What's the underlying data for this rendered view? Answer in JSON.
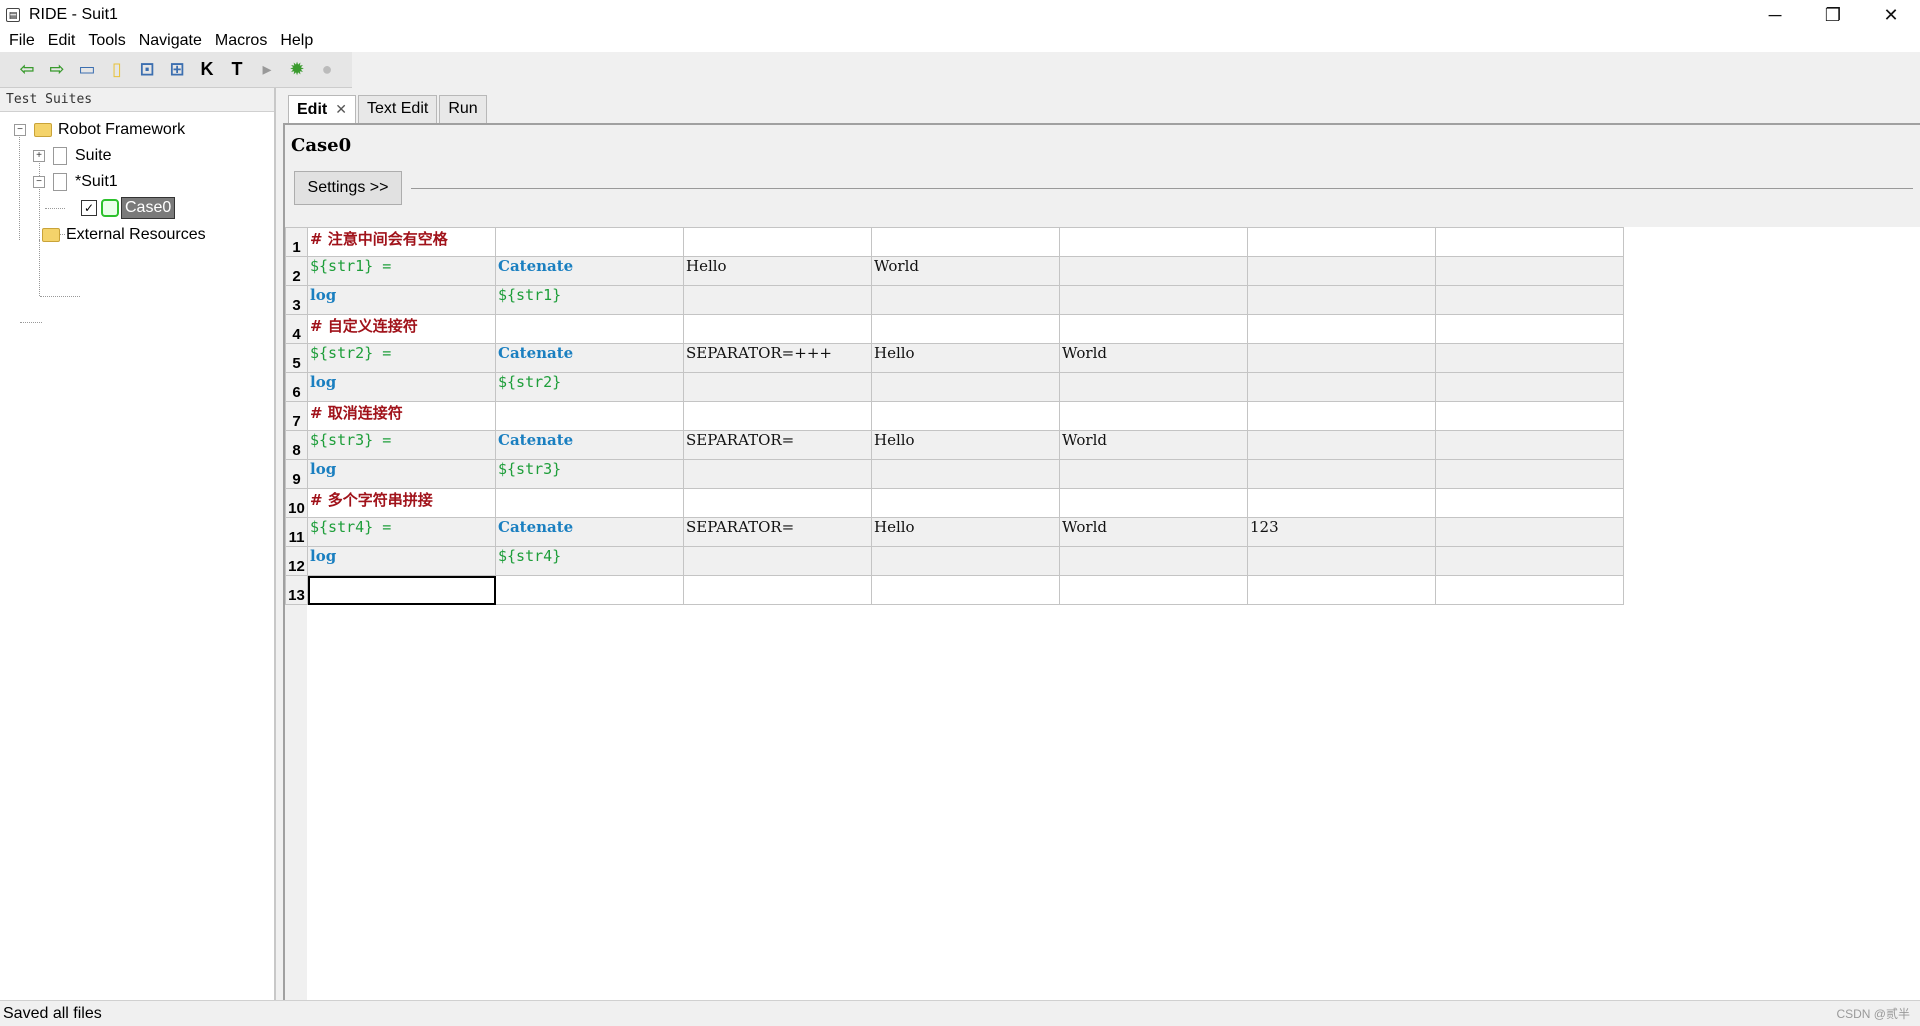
{
  "window": {
    "title": "RIDE - Suit1",
    "controls": {
      "minimize": "─",
      "restore": "❐",
      "close": "✕"
    }
  },
  "menu": [
    "File",
    "Edit",
    "Tools",
    "Navigate",
    "Macros",
    "Help"
  ],
  "toolbar": {
    "icons": [
      "back-icon",
      "forward-icon",
      "open-folder-icon",
      "new-file-icon",
      "save-icon",
      "save-all-icon",
      "keyword-search-icon",
      "test-search-icon",
      "run-icon",
      "debug-icon",
      "stop-icon"
    ],
    "glyphs": [
      "⇦",
      "⇨",
      "▭",
      "▯",
      "⊡",
      "⊞",
      "K",
      "T",
      "▸",
      "✹",
      "●"
    ]
  },
  "left_pane": {
    "header": "Test Suites",
    "tree": {
      "root": "Robot Framework",
      "suite": "Suite",
      "suit1": "*Suit1",
      "case0": "Case0",
      "external": "External Resources"
    }
  },
  "tabs": [
    "Edit",
    "Text Edit",
    "Run"
  ],
  "tab_close": "✕",
  "editor": {
    "case_title": "Case0",
    "settings_button": "Settings >>",
    "rows": [
      [
        "# 注意中间会有空格",
        "",
        "",
        "",
        "",
        "",
        ""
      ],
      [
        "${str1} =",
        "Catenate",
        "Hello",
        "World",
        "",
        "",
        ""
      ],
      [
        "log",
        "${str1}",
        "",
        "",
        "",
        "",
        ""
      ],
      [
        "# 自定义连接符",
        "",
        "",
        "",
        "",
        "",
        ""
      ],
      [
        "${str2} =",
        "Catenate",
        "SEPARATOR=+++",
        "Hello",
        "World",
        "",
        ""
      ],
      [
        "log",
        "${str2}",
        "",
        "",
        "",
        "",
        ""
      ],
      [
        "# 取消连接符",
        "",
        "",
        "",
        "",
        "",
        ""
      ],
      [
        "${str3} =",
        "Catenate",
        "SEPARATOR=",
        "Hello",
        "World",
        "",
        ""
      ],
      [
        "log",
        "${str3}",
        "",
        "",
        "",
        "",
        ""
      ],
      [
        "# 多个字符串拼接",
        "",
        "",
        "",
        "",
        "",
        ""
      ],
      [
        "${str4} =",
        "Catenate",
        "SEPARATOR=",
        "Hello",
        "World",
        "123",
        ""
      ],
      [
        "log",
        "${str4}",
        "",
        "",
        "",
        "",
        ""
      ],
      [
        "",
        "",
        "",
        "",
        "",
        "",
        ""
      ]
    ]
  },
  "status": {
    "text": "Saved all files",
    "watermark": "CSDN @贰半"
  },
  "colors": {
    "comment": "#a0121a",
    "variable": "#1e9e3a",
    "keyword": "#1a7fc0"
  }
}
